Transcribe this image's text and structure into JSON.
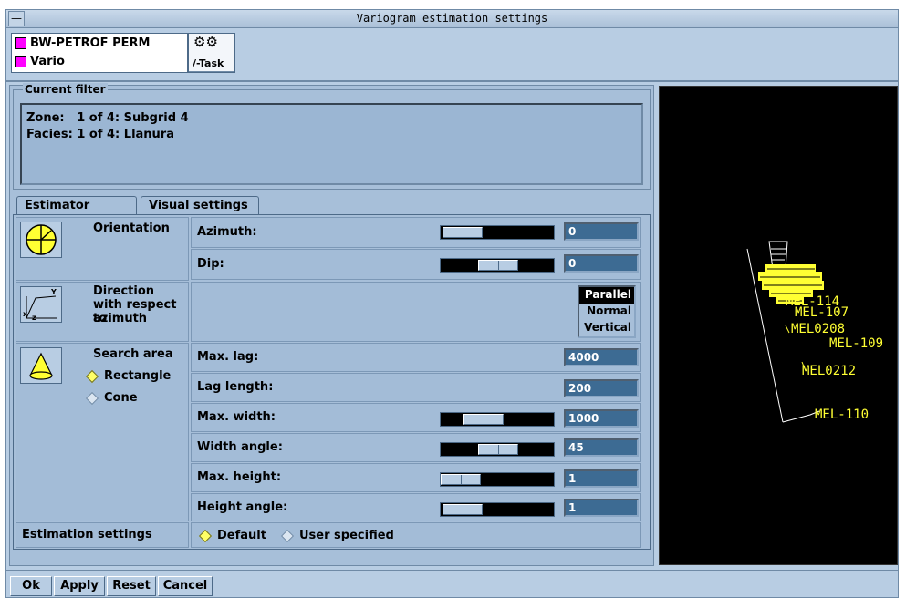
{
  "window": {
    "title": "Variogram estimation settings",
    "menu_glyph": "—"
  },
  "toolbar": {
    "objects": [
      {
        "name": "BW-PETROF PERM",
        "color": "#ff00ff"
      },
      {
        "name": "Vario",
        "color": "#ff00ff"
      }
    ],
    "task_button": {
      "label": "/-Task",
      "icon": "gears-icon"
    }
  },
  "filter": {
    "legend": "Current filter",
    "zone": "Zone:   1 of 4: Subgrid 4",
    "facies": "Facies: 1 of 4: Llanura"
  },
  "tabs": {
    "estimator": "Estimator",
    "visual": "Visual settings"
  },
  "orientation": {
    "label": "Orientation",
    "icon": "compass-icon",
    "azimuth": {
      "label": "Azimuth:",
      "value": "0",
      "slider_fraction": 0.1
    },
    "dip": {
      "label": "Dip:",
      "value": "0",
      "slider_fraction": 0.5
    }
  },
  "direction": {
    "label_line1": "Direction",
    "label_line2": "with respect to",
    "label_line3": "azimuth",
    "icon": "axes-icon",
    "options": [
      "Parallel",
      "Normal",
      "Vertical"
    ],
    "selected": "Parallel"
  },
  "search": {
    "label": "Search area",
    "icon": "cone-icon",
    "options": [
      "Rectangle",
      "Cone"
    ],
    "selected": "Rectangle",
    "max_lag": {
      "label": "Max. lag:",
      "value": "4000"
    },
    "lag_length": {
      "label": "Lag length:",
      "value": "200"
    },
    "max_width": {
      "label": "Max. width:",
      "value": "1000",
      "slider_fraction": 0.3
    },
    "width_angle": {
      "label": "Width angle:",
      "value": "45",
      "slider_fraction": 0.5
    },
    "max_height": {
      "label": "Max. height:",
      "value": "1",
      "slider_fraction": 0.0
    },
    "height_angle": {
      "label": "Height angle:",
      "value": "1",
      "slider_fraction": 0.05
    }
  },
  "estimation": {
    "label": "Estimation settings",
    "options": [
      "Default",
      "User specified"
    ],
    "selected": "Default"
  },
  "buttons": {
    "ok": "Ok",
    "apply": "Apply",
    "reset": "Reset",
    "cancel": "Cancel"
  },
  "viewport": {
    "wells": [
      "MEL-107",
      "MEL0208",
      "MEL-109",
      "MEL0212",
      "MEL-110"
    ],
    "cluster_label": "MEL-114",
    "color": "#ffff33"
  }
}
